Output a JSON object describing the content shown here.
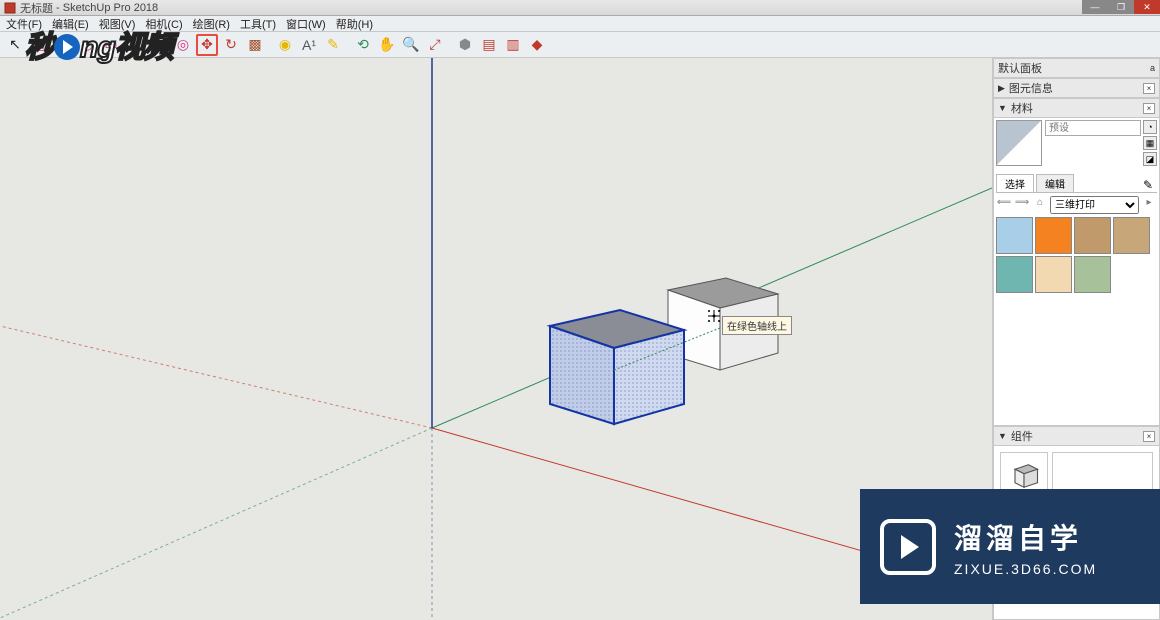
{
  "titlebar": {
    "doc_name": "无标题",
    "app_name": "SketchUp Pro 2018"
  },
  "menubar": {
    "items": [
      "文件(F)",
      "编辑(E)",
      "视图(V)",
      "相机(C)",
      "绘图(R)",
      "工具(T)",
      "窗口(W)",
      "帮助(H)"
    ]
  },
  "toolbar": {
    "tools": [
      {
        "name": "select-tool",
        "glyph": "↖",
        "color": "#222"
      },
      {
        "name": "eraser-tool",
        "glyph": "◧",
        "color": "#d63384"
      },
      {
        "name": "line-tool",
        "glyph": "╱",
        "color": "#d63384"
      },
      {
        "name": "arc-tool",
        "glyph": "◡",
        "color": "#d63384"
      },
      {
        "name": "rectangle-tool",
        "glyph": "▭",
        "color": "#d63384"
      },
      {
        "name": "circle-tool",
        "glyph": "○",
        "color": "#d63384"
      },
      {
        "name": "pushpull-tool",
        "glyph": "▦",
        "color": "#a0522d"
      },
      {
        "name": "offset-tool",
        "glyph": "◎",
        "color": "#d63384"
      },
      {
        "name": "move-tool",
        "glyph": "✥",
        "color": "#c0392b",
        "highlight": true
      },
      {
        "name": "rotate-tool",
        "glyph": "↻",
        "color": "#c0392b"
      },
      {
        "name": "scale-tool",
        "glyph": "▩",
        "color": "#a0522d"
      },
      {
        "name": "sep",
        "sep": true
      },
      {
        "name": "tape-tool",
        "glyph": "◉",
        "color": "#e6b800"
      },
      {
        "name": "text-tool",
        "glyph": "A¹",
        "color": "#555"
      },
      {
        "name": "paint-tool",
        "glyph": "✎",
        "color": "#e6b800"
      },
      {
        "name": "sep2",
        "sep": true
      },
      {
        "name": "orbit-tool",
        "glyph": "⟲",
        "color": "#2e8b57"
      },
      {
        "name": "pan-tool",
        "glyph": "✋",
        "color": "#e6b800"
      },
      {
        "name": "zoom-tool",
        "glyph": "🔍",
        "color": "#555"
      },
      {
        "name": "zoom-extents-tool",
        "glyph": "⤢",
        "color": "#c0392b"
      },
      {
        "name": "sep3",
        "sep": true
      },
      {
        "name": "3dw-tool",
        "glyph": "⬢",
        "color": "#888"
      },
      {
        "name": "layers-tool",
        "glyph": "▤",
        "color": "#c0392b"
      },
      {
        "name": "layers2-tool",
        "glyph": "▥",
        "color": "#c0392b"
      },
      {
        "name": "ext-tool",
        "glyph": "◆",
        "color": "#c0392b"
      }
    ]
  },
  "viewport": {
    "tooltip_text": "在绿色轴线上",
    "axes": {
      "x_color": "#c0392b",
      "y_color": "#2e8b57",
      "z_color": "#1f3a93"
    }
  },
  "sidepanels": {
    "default_panel_title": "默认面板",
    "entity_info_title": "图元信息",
    "materials": {
      "title": "材料",
      "preset_placeholder": "预设",
      "tab_select": "选择",
      "tab_edit": "编辑",
      "category": "三维打印",
      "swatches": [
        "#a9cfe8",
        "#f58220",
        "#c19a6b",
        "#c7a77a",
        "#6fb6b0",
        "#f3d9b1",
        "#a7c29a"
      ]
    },
    "components": {
      "title": "组件"
    }
  },
  "watermarks": {
    "top_left_pre": "秒",
    "top_left_mid": "ng",
    "top_left_orange": "视频",
    "bottom_big": "溜溜自学",
    "bottom_small": "ZIXUE.3D66.COM"
  }
}
